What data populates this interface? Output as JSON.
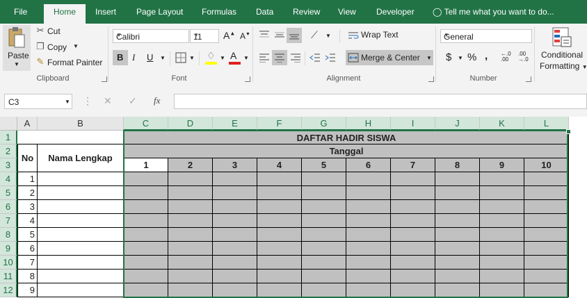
{
  "tabs": {
    "file": "File",
    "home": "Home",
    "insert": "Insert",
    "page_layout": "Page Layout",
    "formulas": "Formulas",
    "data": "Data",
    "review": "Review",
    "view": "View",
    "developer": "Developer",
    "tell_me": "Tell me what you want to do..."
  },
  "clipboard": {
    "paste": "Paste",
    "cut": "Cut",
    "copy": "Copy",
    "format_painter": "Format Painter",
    "label": "Clipboard"
  },
  "font": {
    "name": "Calibri",
    "size": "11",
    "grow": "A",
    "shrink": "A",
    "bold": "B",
    "italic": "I",
    "underline": "U",
    "color_letter": "A",
    "label": "Font"
  },
  "alignment": {
    "wrap_text": "Wrap Text",
    "merge_center": "Merge & Center",
    "label": "Alignment"
  },
  "number": {
    "format": "General",
    "currency": "$",
    "percent": "%",
    "comma": ",",
    "inc_decimal": "←.0 .00",
    "dec_decimal": ".00 →.0",
    "label": "Number"
  },
  "styles": {
    "conditional": "Conditional",
    "formatting": "Formatting"
  },
  "formula_bar": {
    "name_box": "C3",
    "fx": "fx",
    "value": ""
  },
  "colors": {
    "accent": "#217346",
    "header_selected": "#d2e6da",
    "cell_fill": "#c0c0c0"
  },
  "sheet": {
    "columns": [
      "A",
      "B",
      "C",
      "D",
      "E",
      "F",
      "G",
      "H",
      "I",
      "J",
      "K",
      "L"
    ],
    "rows": [
      "1",
      "2",
      "3",
      "4",
      "5",
      "6",
      "7",
      "8",
      "9",
      "10",
      "11",
      "12"
    ],
    "title": "DAFTAR HADIR SISWA",
    "no_header": "No",
    "name_header": "Nama Lengkap",
    "date_header": "Tanggal",
    "days": [
      "1",
      "2",
      "3",
      "4",
      "5",
      "6",
      "7",
      "8",
      "9",
      "10"
    ],
    "numbers": [
      "1",
      "2",
      "3",
      "4",
      "5",
      "6",
      "7",
      "8",
      "9"
    ]
  }
}
